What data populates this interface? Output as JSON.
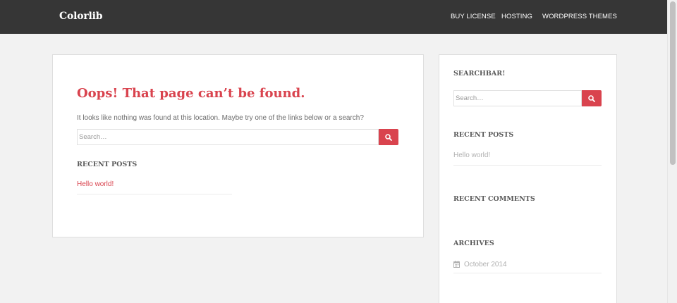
{
  "navbar": {
    "brand": "Colorlib",
    "links": [
      "BUY LICENSE",
      "HOSTING",
      "WORDPRESS THEMES"
    ]
  },
  "main": {
    "title": "Oops! That page can’t be found.",
    "intro": "It looks like nothing was found at this location. Maybe try one of the links below or a search?",
    "search": {
      "placeholder": "Search…"
    },
    "recent_posts": {
      "title": "RECENT POSTS",
      "items": [
        "Hello world!"
      ]
    }
  },
  "sidebar": {
    "searchbar": {
      "title": "SEARCHBAR!",
      "placeholder": "Search…"
    },
    "recent_posts": {
      "title": "RECENT POSTS",
      "items": [
        "Hello world!"
      ]
    },
    "recent_comments": {
      "title": "RECENT COMMENTS"
    },
    "archives": {
      "title": "ARCHIVES",
      "items": [
        "October 2014"
      ]
    }
  },
  "icons": {
    "search_button": "search-icon",
    "archive_item": "calendar-icon"
  },
  "colors": {
    "navbar_bg": "#363636",
    "accent": "#d9434e",
    "page_bg": "#f2f2f2",
    "muted_link": "#b0b0b0"
  }
}
